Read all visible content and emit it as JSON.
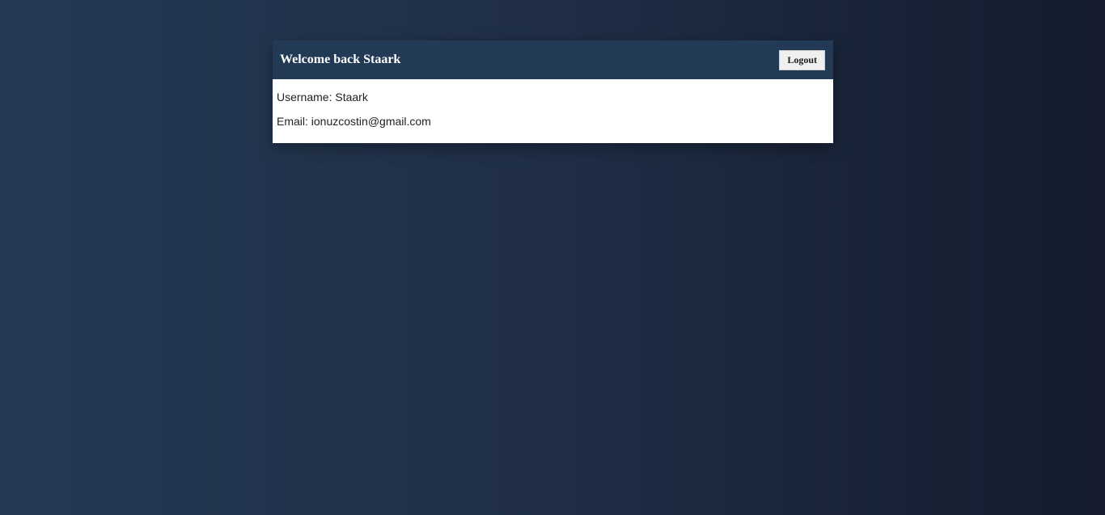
{
  "header": {
    "welcome_text": "Welcome back Staark",
    "logout_label": "Logout"
  },
  "profile": {
    "username_line": "Username: Staark",
    "email_line": "Email: ionuzcostin@gmail.com"
  },
  "colors": {
    "header_background": "#233a56",
    "page_background_left": "#253a54",
    "page_background_right": "#141c2e",
    "card_body_background": "#ffffff"
  }
}
